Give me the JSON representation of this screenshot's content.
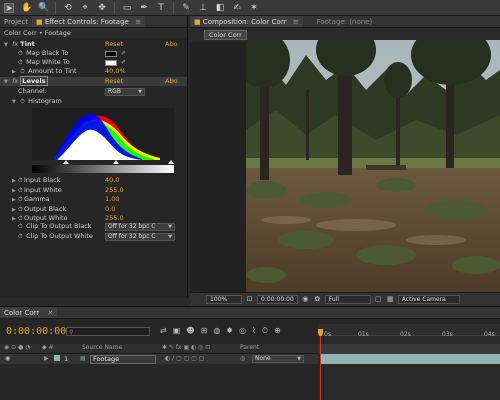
{
  "toolbar": {
    "tools": [
      {
        "name": "selection-tool",
        "glyph": "➤"
      },
      {
        "name": "hand-tool",
        "glyph": "✋"
      },
      {
        "name": "zoom-tool",
        "glyph": "🔍"
      },
      {
        "name": "rotate-tool",
        "glyph": "⟲"
      },
      {
        "name": "camera-tool",
        "glyph": "⌖"
      },
      {
        "name": "pan-behind-tool",
        "glyph": "✥"
      },
      {
        "name": "rectangle-tool",
        "glyph": "▭"
      },
      {
        "name": "pen-tool",
        "glyph": "✒"
      },
      {
        "name": "type-tool",
        "glyph": "T"
      },
      {
        "name": "brush-tool",
        "glyph": "✎"
      },
      {
        "name": "clone-stamp-tool",
        "glyph": "⊥"
      },
      {
        "name": "eraser-tool",
        "glyph": "◧"
      },
      {
        "name": "roto-brush-tool",
        "glyph": "✍"
      },
      {
        "name": "puppet-tool",
        "glyph": "✶"
      }
    ]
  },
  "left_panel": {
    "tabs": [
      "Project",
      "Effect Controls: Footage"
    ],
    "breadcrumb": "Color Corr • Footage",
    "tint": {
      "label": "Tint",
      "reset": "Reset",
      "about": "Abo",
      "map_black": "Map Black To",
      "map_white": "Map White To",
      "amount_label": "Amount to Tint",
      "amount_value": "40.0%"
    },
    "levels": {
      "label": "Levels",
      "reset": "Reset",
      "about": "Abo",
      "channel_label": "Channel:",
      "channel_value": "RGB",
      "histogram_label": "Histogram",
      "params": [
        {
          "label": "Input Black",
          "value": "40.0"
        },
        {
          "label": "Input White",
          "value": "255.0"
        },
        {
          "label": "Gamma",
          "value": "1.00"
        },
        {
          "label": "Output Black",
          "value": "0.0"
        },
        {
          "label": "Output White",
          "value": "255.0"
        }
      ],
      "clip_black_label": "Clip To Output Black",
      "clip_black_value": "Off for 32 bpc C",
      "clip_white_label": "Clip To Output White",
      "clip_white_value": "Off for 32 bpc C"
    }
  },
  "comp_panel": {
    "tab": "Composition: Color Corr",
    "footage_tab": "Footage: (none)",
    "subtab": "Color Corr",
    "zoom": "100%",
    "timecode": "0:00:00:00",
    "resolution": "Full",
    "camera": "Active Camera"
  },
  "timeline": {
    "tab": "Color Corr",
    "timecode": "0:00:00:00",
    "search_placeholder": "",
    "col_source": "Source Name",
    "col_parent": "Parent",
    "layer_number": "1",
    "layer_name": "Footage",
    "parent_value": "None",
    "ruler": [
      "0s",
      "01s",
      "02s",
      "03s",
      "04s"
    ]
  },
  "colors": {
    "accent": "#e3a530",
    "panel": "#262626",
    "layer_bar": "#8fb5b5",
    "cti": "#d23a2a"
  }
}
